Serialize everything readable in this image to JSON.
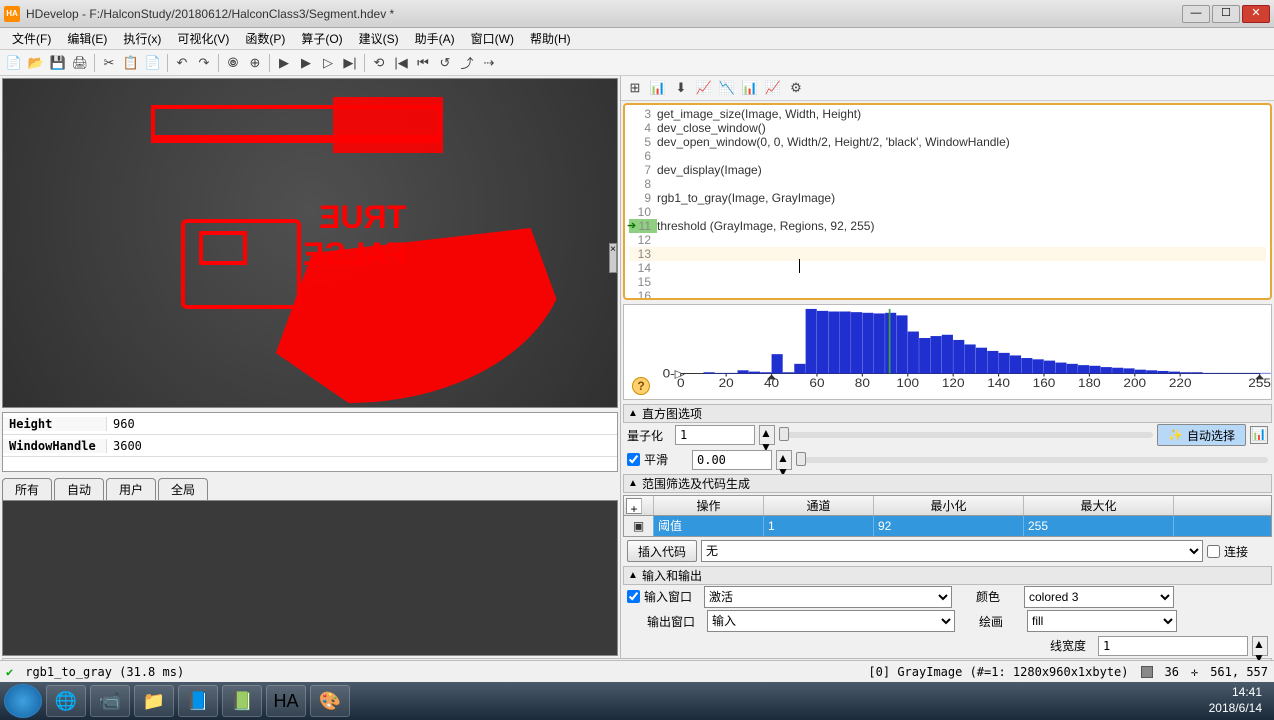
{
  "window": {
    "app_icon": "HA",
    "title": "HDevelop - F:/HalconStudy/20180612/HalconClass3/Segment.hdev *"
  },
  "menu": [
    "文件(F)",
    "编辑(E)",
    "执行(x)",
    "可视化(V)",
    "函数(P)",
    "算子(O)",
    "建议(S)",
    "助手(A)",
    "窗口(W)",
    "帮助(H)"
  ],
  "toolbar_icons": [
    "📄",
    "📂",
    "💾",
    "🖨",
    "|",
    "✂",
    "📋",
    "📄",
    "|",
    "↶",
    "↷",
    "|",
    "🞋",
    "⊕",
    "|",
    "▶",
    "▶",
    "▷",
    "▶|",
    "|",
    "⟲",
    "|◀",
    "⏮",
    "↺",
    "⤴",
    "⇢"
  ],
  "right_toolbar_icons": [
    "⊞",
    "📊",
    "⬇",
    "📈",
    "📉",
    "📊",
    "📈",
    "⚙"
  ],
  "editor": {
    "lines": [
      {
        "n": 3,
        "text": "get_image_size(Image, Width, Height)"
      },
      {
        "n": 4,
        "text": "dev_close_window()"
      },
      {
        "n": 5,
        "text": "dev_open_window(0, 0, Width/2, Height/2, 'black', WindowHandle)"
      },
      {
        "n": 6,
        "text": ""
      },
      {
        "n": 7,
        "text": "dev_display(Image)"
      },
      {
        "n": 8,
        "text": ""
      },
      {
        "n": 9,
        "text": "rgb1_to_gray(Image, GrayImage)"
      },
      {
        "n": 10,
        "text": ""
      },
      {
        "n": 11,
        "text": "threshold (GrayImage, Regions, 92, 255)",
        "mark": true
      },
      {
        "n": 12,
        "text": ""
      },
      {
        "n": 13,
        "text": "",
        "hl": true
      },
      {
        "n": 14,
        "text": ""
      },
      {
        "n": 15,
        "text": ""
      },
      {
        "n": 16,
        "text": ""
      }
    ]
  },
  "chart_data": {
    "type": "bar",
    "title": "",
    "xlabel": "",
    "ylabel": "",
    "xlim": [
      0,
      255
    ],
    "ylim": [
      0,
      1
    ],
    "ticks": [
      0,
      20,
      40,
      60,
      80,
      100,
      120,
      140,
      160,
      180,
      200,
      220,
      255
    ],
    "categories": [
      0,
      5,
      10,
      15,
      20,
      25,
      30,
      35,
      40,
      45,
      50,
      55,
      60,
      65,
      70,
      75,
      80,
      85,
      90,
      95,
      100,
      105,
      110,
      115,
      120,
      125,
      130,
      135,
      140,
      145,
      150,
      155,
      160,
      165,
      170,
      175,
      180,
      185,
      190,
      195,
      200,
      205,
      210,
      215,
      220,
      225,
      230,
      235,
      240,
      245,
      250,
      255
    ],
    "values": [
      0.0,
      0.0,
      0.02,
      0.01,
      0.01,
      0.05,
      0.03,
      0.02,
      0.3,
      0.02,
      0.15,
      1.0,
      0.97,
      0.96,
      0.96,
      0.95,
      0.94,
      0.93,
      0.94,
      0.9,
      0.65,
      0.55,
      0.58,
      0.6,
      0.52,
      0.45,
      0.4,
      0.35,
      0.32,
      0.28,
      0.24,
      0.22,
      0.2,
      0.17,
      0.15,
      0.13,
      0.12,
      0.1,
      0.09,
      0.08,
      0.06,
      0.05,
      0.04,
      0.03,
      0.02,
      0.02,
      0.01,
      0.01,
      0.01,
      0.01,
      0.01,
      0.01
    ],
    "vline": 92,
    "vline_color": "#40a040",
    "marker_y0": 40
  },
  "vars": [
    {
      "name": "Height",
      "value": "960"
    },
    {
      "name": "WindowHandle",
      "value": "3600"
    }
  ],
  "tabs": [
    "所有",
    "自动",
    "用户",
    "全局"
  ],
  "sections": {
    "hist_opts": "直方图选项",
    "quant": "量子化",
    "quant_val": "1",
    "smooth": "平滑",
    "smooth_val": "0.00",
    "auto_btn": "自动选择",
    "range_gen": "范围筛选及代码生成",
    "insert_code": "插入代码",
    "insert_sel": "无",
    "connect": "连接",
    "io": "输入和输出",
    "in_win": "输入窗口",
    "in_win_val": "激活",
    "out_win": "输出窗口",
    "out_win_val": "输入",
    "color": "颜色",
    "color_val": "colored 3",
    "draw": "绘画",
    "draw_val": "fill",
    "lw": "线宽度",
    "lw_val": "1"
  },
  "table": {
    "headers": [
      "",
      "操作",
      "通道",
      "最小化",
      "最大化"
    ],
    "row": [
      "-",
      "阈值",
      "1",
      "92",
      "255"
    ]
  },
  "status": {
    "left_icon": "✔",
    "left": "rgb1_to_gray (31.8 ms)",
    "mid": "[0] GrayImage (#=1: 1280x960x1xbyte)",
    "val1": "36",
    "val2": "561, 557"
  },
  "taskbar": {
    "time": "14:41",
    "date": "2018/6/14",
    "icons": [
      "🌐",
      "📹",
      "📁",
      "📘",
      "📗",
      "HA",
      "🎨"
    ]
  }
}
